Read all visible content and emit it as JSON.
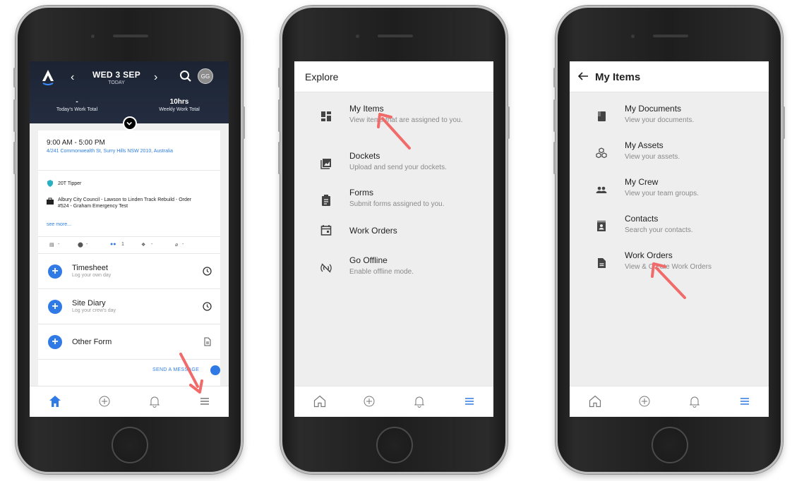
{
  "phone1": {
    "header": {
      "date": "WED 3 SEP",
      "date_sub": "TODAY",
      "prev": "‹",
      "next": "›",
      "avatar": "GG",
      "stat_left_value": "-",
      "stat_left_label": "Today's Work Total",
      "stat_right_value": "10hrs",
      "stat_right_label": "Weekly Work Total"
    },
    "shift": {
      "time": "9:00 AM - 5:00 PM",
      "address": "4/241 Commonwealth St, Surry Hills NSW 2010, Australia",
      "asset": "20T Tipper",
      "job": "Albury City Council - Lawson to Linden Track Rebuild - Order #524 - Graham Emergency Test",
      "see_more": "see more...",
      "counts": [
        "-",
        "-",
        "1",
        "-",
        "-"
      ]
    },
    "forms": [
      {
        "title": "Timesheet",
        "subtitle": "Log your own day",
        "icon": "clock-icon"
      },
      {
        "title": "Site Diary",
        "subtitle": "Log your crew's day",
        "icon": "clock-icon"
      },
      {
        "title": "Other Form",
        "subtitle": "",
        "icon": "document-icon"
      }
    ],
    "send_message": "SEND A MESSAGE"
  },
  "phone2": {
    "title": "Explore",
    "items": [
      {
        "title": "My Items",
        "subtitle": "View items that are assigned to you.",
        "icon": "dashboard-icon"
      },
      {
        "title": "Dockets",
        "subtitle": "Upload and send your dockets.",
        "icon": "image-icon"
      },
      {
        "title": "Forms",
        "subtitle": "Submit forms assigned to you.",
        "icon": "clipboard-icon"
      },
      {
        "title": "Work Orders",
        "subtitle": "",
        "icon": "calendar-icon"
      },
      {
        "title": "Go Offline",
        "subtitle": "Enable offline mode.",
        "icon": "offline-icon"
      }
    ]
  },
  "phone3": {
    "title": "My Items",
    "items": [
      {
        "title": "My Documents",
        "subtitle": "View your documents.",
        "icon": "book-icon"
      },
      {
        "title": "My Assets",
        "subtitle": "View your assets.",
        "icon": "cubes-icon"
      },
      {
        "title": "My Crew",
        "subtitle": "View your team groups.",
        "icon": "people-icon"
      },
      {
        "title": "Contacts",
        "subtitle": "Search your contacts.",
        "icon": "contact-icon"
      },
      {
        "title": "Work Orders",
        "subtitle": "View & Create Work Orders",
        "icon": "file-icon"
      }
    ]
  },
  "colors": {
    "accent": "#2f7ae5",
    "header_dark": "#1f2738",
    "annotation_arrow": "#f26b6b"
  }
}
